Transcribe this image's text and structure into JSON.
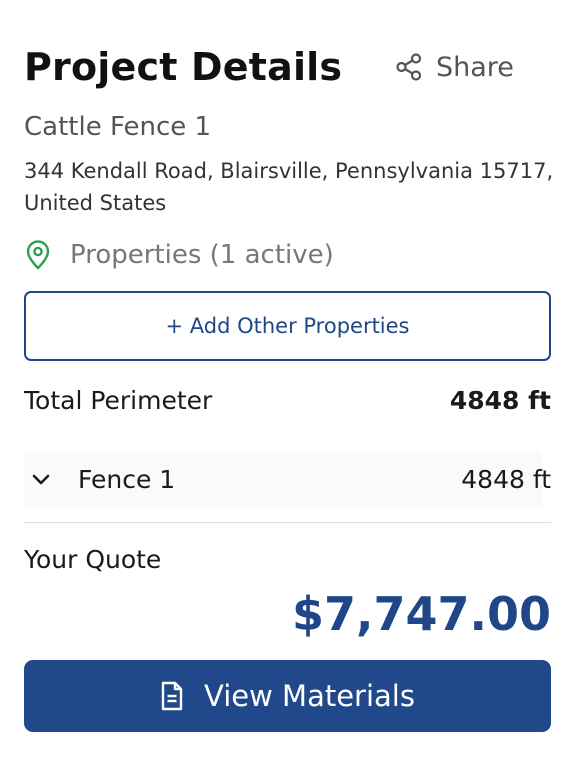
{
  "header": {
    "title": "Project Details",
    "share_label": "Share"
  },
  "project": {
    "name": "Cattle Fence 1",
    "address": "344 Kendall Road, Blairsville, Pennsylvania 15717, United States"
  },
  "properties": {
    "label": "Properties (1 active)",
    "icon": "map-pin-icon"
  },
  "add_properties_label": "+ Add Other Properties",
  "perimeter": {
    "label": "Total Perimeter",
    "value": "4848 ft"
  },
  "fences": [
    {
      "name": "Fence 1",
      "length": "4848 ft",
      "icon": "chevron-down-icon"
    }
  ],
  "quote": {
    "label": "Your Quote",
    "value": "$7,747.00"
  },
  "materials_button": {
    "label": "View Materials",
    "icon": "document-icon"
  },
  "colors": {
    "brand": "#21488a",
    "pin": "#2e9e4f",
    "muted_text": "#555555"
  }
}
